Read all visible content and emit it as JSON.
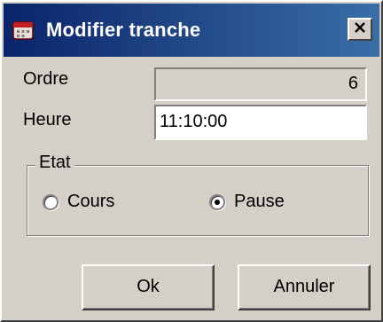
{
  "window": {
    "title": "Modifier tranche"
  },
  "form": {
    "ordre_label": "Ordre",
    "ordre_value": "6",
    "heure_label": "Heure",
    "heure_value": "11:10:00"
  },
  "etat": {
    "legend": "Etat",
    "options": [
      {
        "label": "Cours",
        "selected": false
      },
      {
        "label": "Pause",
        "selected": true
      }
    ]
  },
  "buttons": {
    "ok_label": "Ok",
    "cancel_label": "Annuler"
  },
  "icons": {
    "app": "app-window-icon",
    "close": "close-icon"
  },
  "colors": {
    "titlebar_start": "#0a246a",
    "titlebar_end": "#3a6ea5",
    "face": "#d4d0c8"
  }
}
